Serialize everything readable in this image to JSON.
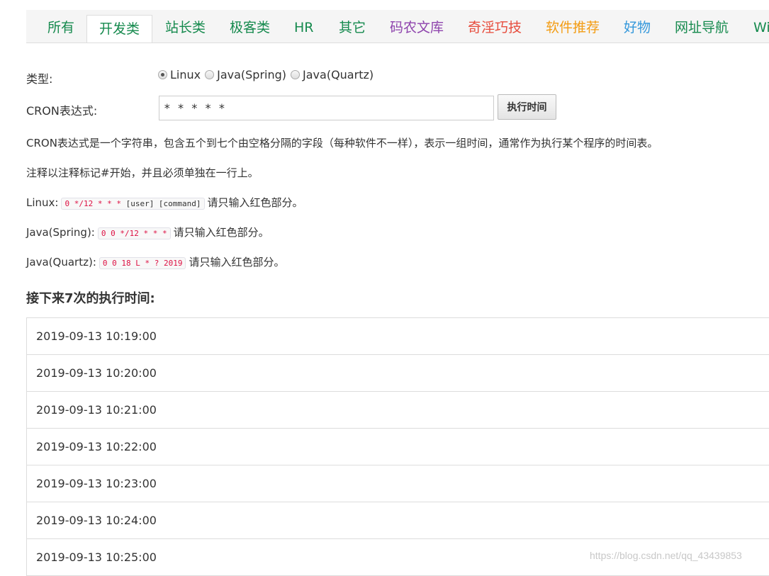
{
  "tabs": [
    {
      "label": "所有",
      "color": "#168a4e"
    },
    {
      "label": "开发类",
      "color": "#168a4e",
      "active": true
    },
    {
      "label": "站长类",
      "color": "#168a4e"
    },
    {
      "label": "极客类",
      "color": "#168a4e"
    },
    {
      "label": "HR",
      "color": "#168a4e"
    },
    {
      "label": "其它",
      "color": "#168a4e"
    },
    {
      "label": "码农文库",
      "color": "#8e44ad"
    },
    {
      "label": "奇淫巧技",
      "color": "#e74c3c"
    },
    {
      "label": "软件推荐",
      "color": "#f39c12"
    },
    {
      "label": "好物",
      "color": "#3498db"
    },
    {
      "label": "网址导航",
      "color": "#168a4e"
    },
    {
      "label": "Wi",
      "color": "#168a4e"
    }
  ],
  "form": {
    "type_label": "类型:",
    "radios": [
      {
        "label": "Linux",
        "checked": true
      },
      {
        "label": "Java(Spring)",
        "checked": false
      },
      {
        "label": "Java(Quartz)",
        "checked": false
      }
    ],
    "cron_label": "CRON表达式:",
    "cron_value": "* * * * *",
    "exec_button": "执行时间"
  },
  "description": {
    "line1": "CRON表达式是一个字符串，包含五个到七个由空格分隔的字段（每种软件不一样），表示一组时间，通常作为执行某个程序的时间表。",
    "line2": "注释以注释标记#开始，并且必须单独在一行上。",
    "linux": {
      "label": "Linux:",
      "red": "0 */12 * * *",
      "rest": " [user] [command]",
      "hint": "请只输入红色部分。"
    },
    "spring": {
      "label": "Java(Spring):",
      "red": "0 0 */12 * * *",
      "hint": "请只输入红色部分。"
    },
    "quartz": {
      "label": "Java(Quartz):",
      "red": "0 0 18 L * ? 2019",
      "hint": "请只输入红色部分。"
    }
  },
  "results": {
    "title": "接下来7次的执行时间:",
    "times": [
      "2019-09-13 10:19:00",
      "2019-09-13 10:20:00",
      "2019-09-13 10:21:00",
      "2019-09-13 10:22:00",
      "2019-09-13 10:23:00",
      "2019-09-13 10:24:00",
      "2019-09-13 10:25:00"
    ]
  },
  "watermark": "https://blog.csdn.net/qq_43439853"
}
